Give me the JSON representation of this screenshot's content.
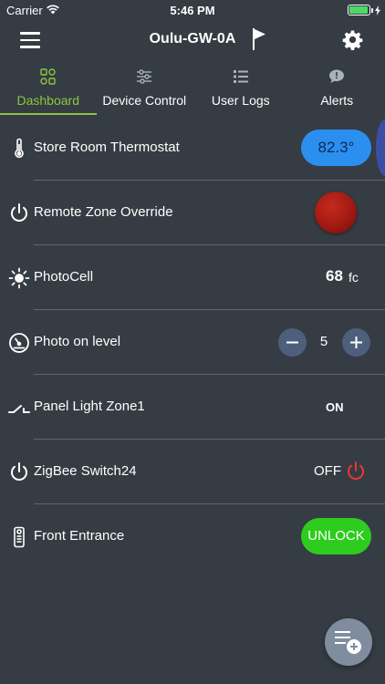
{
  "status_bar": {
    "carrier": "Carrier",
    "time": "5:46 PM"
  },
  "header": {
    "title": "Oulu-GW-0A"
  },
  "tabs": [
    {
      "label": "Dashboard",
      "icon": "dashboard-icon",
      "active": true
    },
    {
      "label": "Device Control",
      "icon": "sliders-icon",
      "active": false
    },
    {
      "label": "User Logs",
      "icon": "list-icon",
      "active": false
    },
    {
      "label": "Alerts",
      "icon": "alert-bubble-icon",
      "active": false
    }
  ],
  "devices": [
    {
      "label": "Store Room Thermostat",
      "icon": "thermometer-icon",
      "value": "82.3°"
    },
    {
      "label": "Remote Zone Override",
      "icon": "power-icon"
    },
    {
      "label": "PhotoCell",
      "icon": "sun-icon",
      "value": "68",
      "unit": "fc"
    },
    {
      "label": "Photo on level",
      "icon": "gauge-icon",
      "value": "5"
    },
    {
      "label": "Panel Light Zone1",
      "icon": "switch-icon",
      "value": "ON"
    },
    {
      "label": "ZigBee Switch24",
      "icon": "power-icon",
      "value": "OFF"
    },
    {
      "label": "Front Entrance",
      "icon": "remote-icon",
      "action": "UNLOCK"
    }
  ],
  "colors": {
    "background": "#363c43",
    "accent": "#8cc63f",
    "thermostat_pill": "#2b8ff0",
    "unlock_pill": "#2ecc1e",
    "override_red": "#b3241a",
    "power_off_red": "#e53935"
  }
}
